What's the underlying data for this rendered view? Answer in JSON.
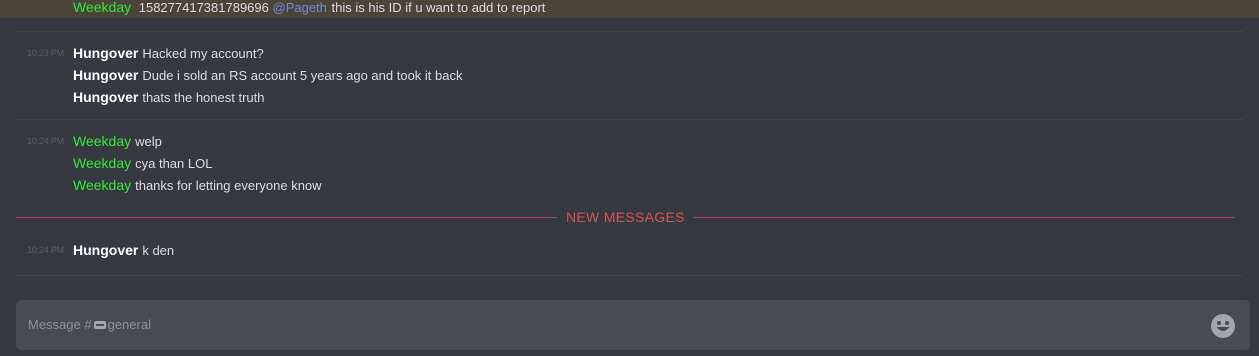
{
  "highlighted": {
    "author": "Weekday",
    "text_before": "158277417381789696",
    "mention": "@Pageth",
    "text_after": "this is his ID if u want to add to report"
  },
  "groups": [
    {
      "timestamp": "10:23 PM",
      "messages": [
        {
          "author": "Hungover",
          "text": "Hacked my account?"
        },
        {
          "author": "Hungover",
          "text": "Dude i sold an RS account 5 years ago and took it back"
        },
        {
          "author": "Hungover",
          "text": "thats the honest truth"
        }
      ]
    },
    {
      "timestamp": "10:24 PM",
      "messages": [
        {
          "author": "Weekday",
          "text": "welp"
        },
        {
          "author": "Weekday",
          "text": "cya than LOL"
        },
        {
          "author": "Weekday",
          "text": "thanks for letting everyone know"
        }
      ]
    },
    {
      "timestamp": "10:24 PM",
      "messages": [
        {
          "author": "Hungover",
          "text": "k den"
        }
      ]
    }
  ],
  "new_messages_label": "NEW MESSAGES",
  "composer": {
    "placeholder_prefix": "Message #",
    "channel": "general",
    "value": ""
  },
  "colors": {
    "background": "#36393f",
    "weekday_name": "#35e83e",
    "mention": "#7289da",
    "new_messages": "#d3545b"
  },
  "icons": {
    "channel": "text-channel-icon",
    "emoji": "emoji-picker-icon"
  }
}
